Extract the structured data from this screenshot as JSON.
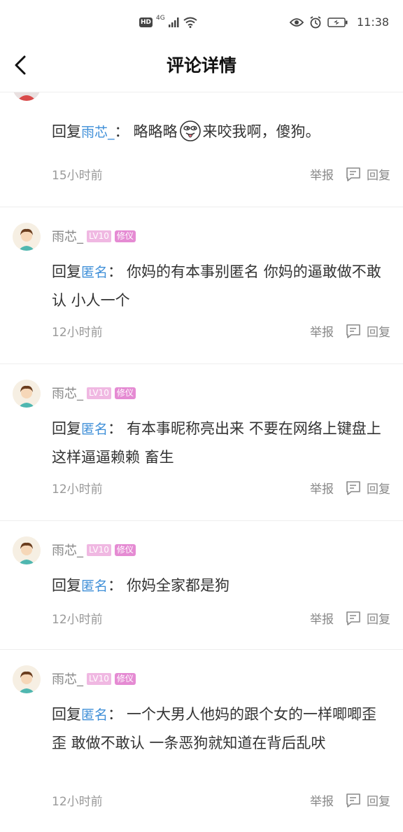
{
  "status_bar": {
    "hd": "HD",
    "network": "4G",
    "time": "11:38"
  },
  "header": {
    "title": "评论详情"
  },
  "comments": [
    {
      "prefix": "回复",
      "target": "雨芯_",
      "text": "略略略",
      "text_after_emoji": "来咬我啊，傻狗。",
      "time": "15小时前",
      "report": "举报",
      "reply": "回复"
    },
    {
      "username": "雨芯_",
      "level": "LV10",
      "tag": "修仪",
      "prefix": "回复",
      "target": "匿名",
      "text": "你妈的有本事别匿名 你妈的逼敢做不敢认 小人一个",
      "time": "12小时前",
      "report": "举报",
      "reply": "回复"
    },
    {
      "username": "雨芯_",
      "level": "LV10",
      "tag": "修仪",
      "prefix": "回复",
      "target": "匿名",
      "text": "有本事昵称亮出来 不要在网络上键盘上这样逼逼赖赖 畜生",
      "time": "12小时前",
      "report": "举报",
      "reply": "回复"
    },
    {
      "username": "雨芯_",
      "level": "LV10",
      "tag": "修仪",
      "prefix": "回复",
      "target": "匿名",
      "text": "你妈全家都是狗",
      "time": "12小时前",
      "report": "举报",
      "reply": "回复"
    },
    {
      "username": "雨芯_",
      "level": "LV10",
      "tag": "修仪",
      "prefix": "回复",
      "target": "匿名",
      "text": "一个大男人他妈的跟个女的一样唧唧歪歪 敢做不敢认 一条恶狗就知道在背后乱吠",
      "time": "12小时前",
      "report": "举报",
      "reply": "回复"
    }
  ],
  "colors": {
    "link": "#3f8fd8",
    "level_badge": "#f0b8e2",
    "tag_badge": "#e58bd3"
  }
}
